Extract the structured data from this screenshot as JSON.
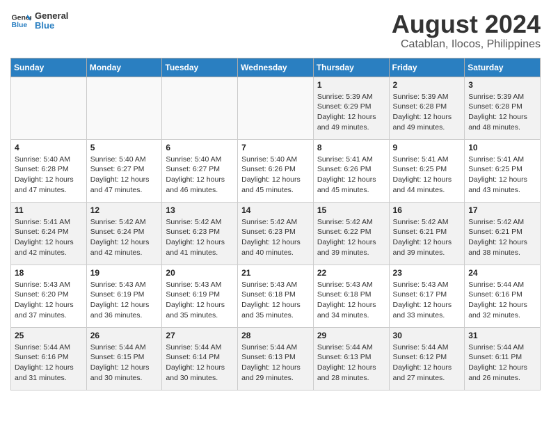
{
  "logo": {
    "text_general": "General",
    "text_blue": "Blue"
  },
  "title": "August 2024",
  "subtitle": "Catablan, Ilocos, Philippines",
  "days_of_week": [
    "Sunday",
    "Monday",
    "Tuesday",
    "Wednesday",
    "Thursday",
    "Friday",
    "Saturday"
  ],
  "weeks": [
    [
      {
        "day": "",
        "info": ""
      },
      {
        "day": "",
        "info": ""
      },
      {
        "day": "",
        "info": ""
      },
      {
        "day": "",
        "info": ""
      },
      {
        "day": "1",
        "info": "Sunrise: 5:39 AM\nSunset: 6:29 PM\nDaylight: 12 hours\nand 49 minutes."
      },
      {
        "day": "2",
        "info": "Sunrise: 5:39 AM\nSunset: 6:28 PM\nDaylight: 12 hours\nand 49 minutes."
      },
      {
        "day": "3",
        "info": "Sunrise: 5:39 AM\nSunset: 6:28 PM\nDaylight: 12 hours\nand 48 minutes."
      }
    ],
    [
      {
        "day": "4",
        "info": "Sunrise: 5:40 AM\nSunset: 6:28 PM\nDaylight: 12 hours\nand 47 minutes."
      },
      {
        "day": "5",
        "info": "Sunrise: 5:40 AM\nSunset: 6:27 PM\nDaylight: 12 hours\nand 47 minutes."
      },
      {
        "day": "6",
        "info": "Sunrise: 5:40 AM\nSunset: 6:27 PM\nDaylight: 12 hours\nand 46 minutes."
      },
      {
        "day": "7",
        "info": "Sunrise: 5:40 AM\nSunset: 6:26 PM\nDaylight: 12 hours\nand 45 minutes."
      },
      {
        "day": "8",
        "info": "Sunrise: 5:41 AM\nSunset: 6:26 PM\nDaylight: 12 hours\nand 45 minutes."
      },
      {
        "day": "9",
        "info": "Sunrise: 5:41 AM\nSunset: 6:25 PM\nDaylight: 12 hours\nand 44 minutes."
      },
      {
        "day": "10",
        "info": "Sunrise: 5:41 AM\nSunset: 6:25 PM\nDaylight: 12 hours\nand 43 minutes."
      }
    ],
    [
      {
        "day": "11",
        "info": "Sunrise: 5:41 AM\nSunset: 6:24 PM\nDaylight: 12 hours\nand 42 minutes."
      },
      {
        "day": "12",
        "info": "Sunrise: 5:42 AM\nSunset: 6:24 PM\nDaylight: 12 hours\nand 42 minutes."
      },
      {
        "day": "13",
        "info": "Sunrise: 5:42 AM\nSunset: 6:23 PM\nDaylight: 12 hours\nand 41 minutes."
      },
      {
        "day": "14",
        "info": "Sunrise: 5:42 AM\nSunset: 6:23 PM\nDaylight: 12 hours\nand 40 minutes."
      },
      {
        "day": "15",
        "info": "Sunrise: 5:42 AM\nSunset: 6:22 PM\nDaylight: 12 hours\nand 39 minutes."
      },
      {
        "day": "16",
        "info": "Sunrise: 5:42 AM\nSunset: 6:21 PM\nDaylight: 12 hours\nand 39 minutes."
      },
      {
        "day": "17",
        "info": "Sunrise: 5:42 AM\nSunset: 6:21 PM\nDaylight: 12 hours\nand 38 minutes."
      }
    ],
    [
      {
        "day": "18",
        "info": "Sunrise: 5:43 AM\nSunset: 6:20 PM\nDaylight: 12 hours\nand 37 minutes."
      },
      {
        "day": "19",
        "info": "Sunrise: 5:43 AM\nSunset: 6:19 PM\nDaylight: 12 hours\nand 36 minutes."
      },
      {
        "day": "20",
        "info": "Sunrise: 5:43 AM\nSunset: 6:19 PM\nDaylight: 12 hours\nand 35 minutes."
      },
      {
        "day": "21",
        "info": "Sunrise: 5:43 AM\nSunset: 6:18 PM\nDaylight: 12 hours\nand 35 minutes."
      },
      {
        "day": "22",
        "info": "Sunrise: 5:43 AM\nSunset: 6:18 PM\nDaylight: 12 hours\nand 34 minutes."
      },
      {
        "day": "23",
        "info": "Sunrise: 5:43 AM\nSunset: 6:17 PM\nDaylight: 12 hours\nand 33 minutes."
      },
      {
        "day": "24",
        "info": "Sunrise: 5:44 AM\nSunset: 6:16 PM\nDaylight: 12 hours\nand 32 minutes."
      }
    ],
    [
      {
        "day": "25",
        "info": "Sunrise: 5:44 AM\nSunset: 6:16 PM\nDaylight: 12 hours\nand 31 minutes."
      },
      {
        "day": "26",
        "info": "Sunrise: 5:44 AM\nSunset: 6:15 PM\nDaylight: 12 hours\nand 30 minutes."
      },
      {
        "day": "27",
        "info": "Sunrise: 5:44 AM\nSunset: 6:14 PM\nDaylight: 12 hours\nand 30 minutes."
      },
      {
        "day": "28",
        "info": "Sunrise: 5:44 AM\nSunset: 6:13 PM\nDaylight: 12 hours\nand 29 minutes."
      },
      {
        "day": "29",
        "info": "Sunrise: 5:44 AM\nSunset: 6:13 PM\nDaylight: 12 hours\nand 28 minutes."
      },
      {
        "day": "30",
        "info": "Sunrise: 5:44 AM\nSunset: 6:12 PM\nDaylight: 12 hours\nand 27 minutes."
      },
      {
        "day": "31",
        "info": "Sunrise: 5:44 AM\nSunset: 6:11 PM\nDaylight: 12 hours\nand 26 minutes."
      }
    ]
  ]
}
